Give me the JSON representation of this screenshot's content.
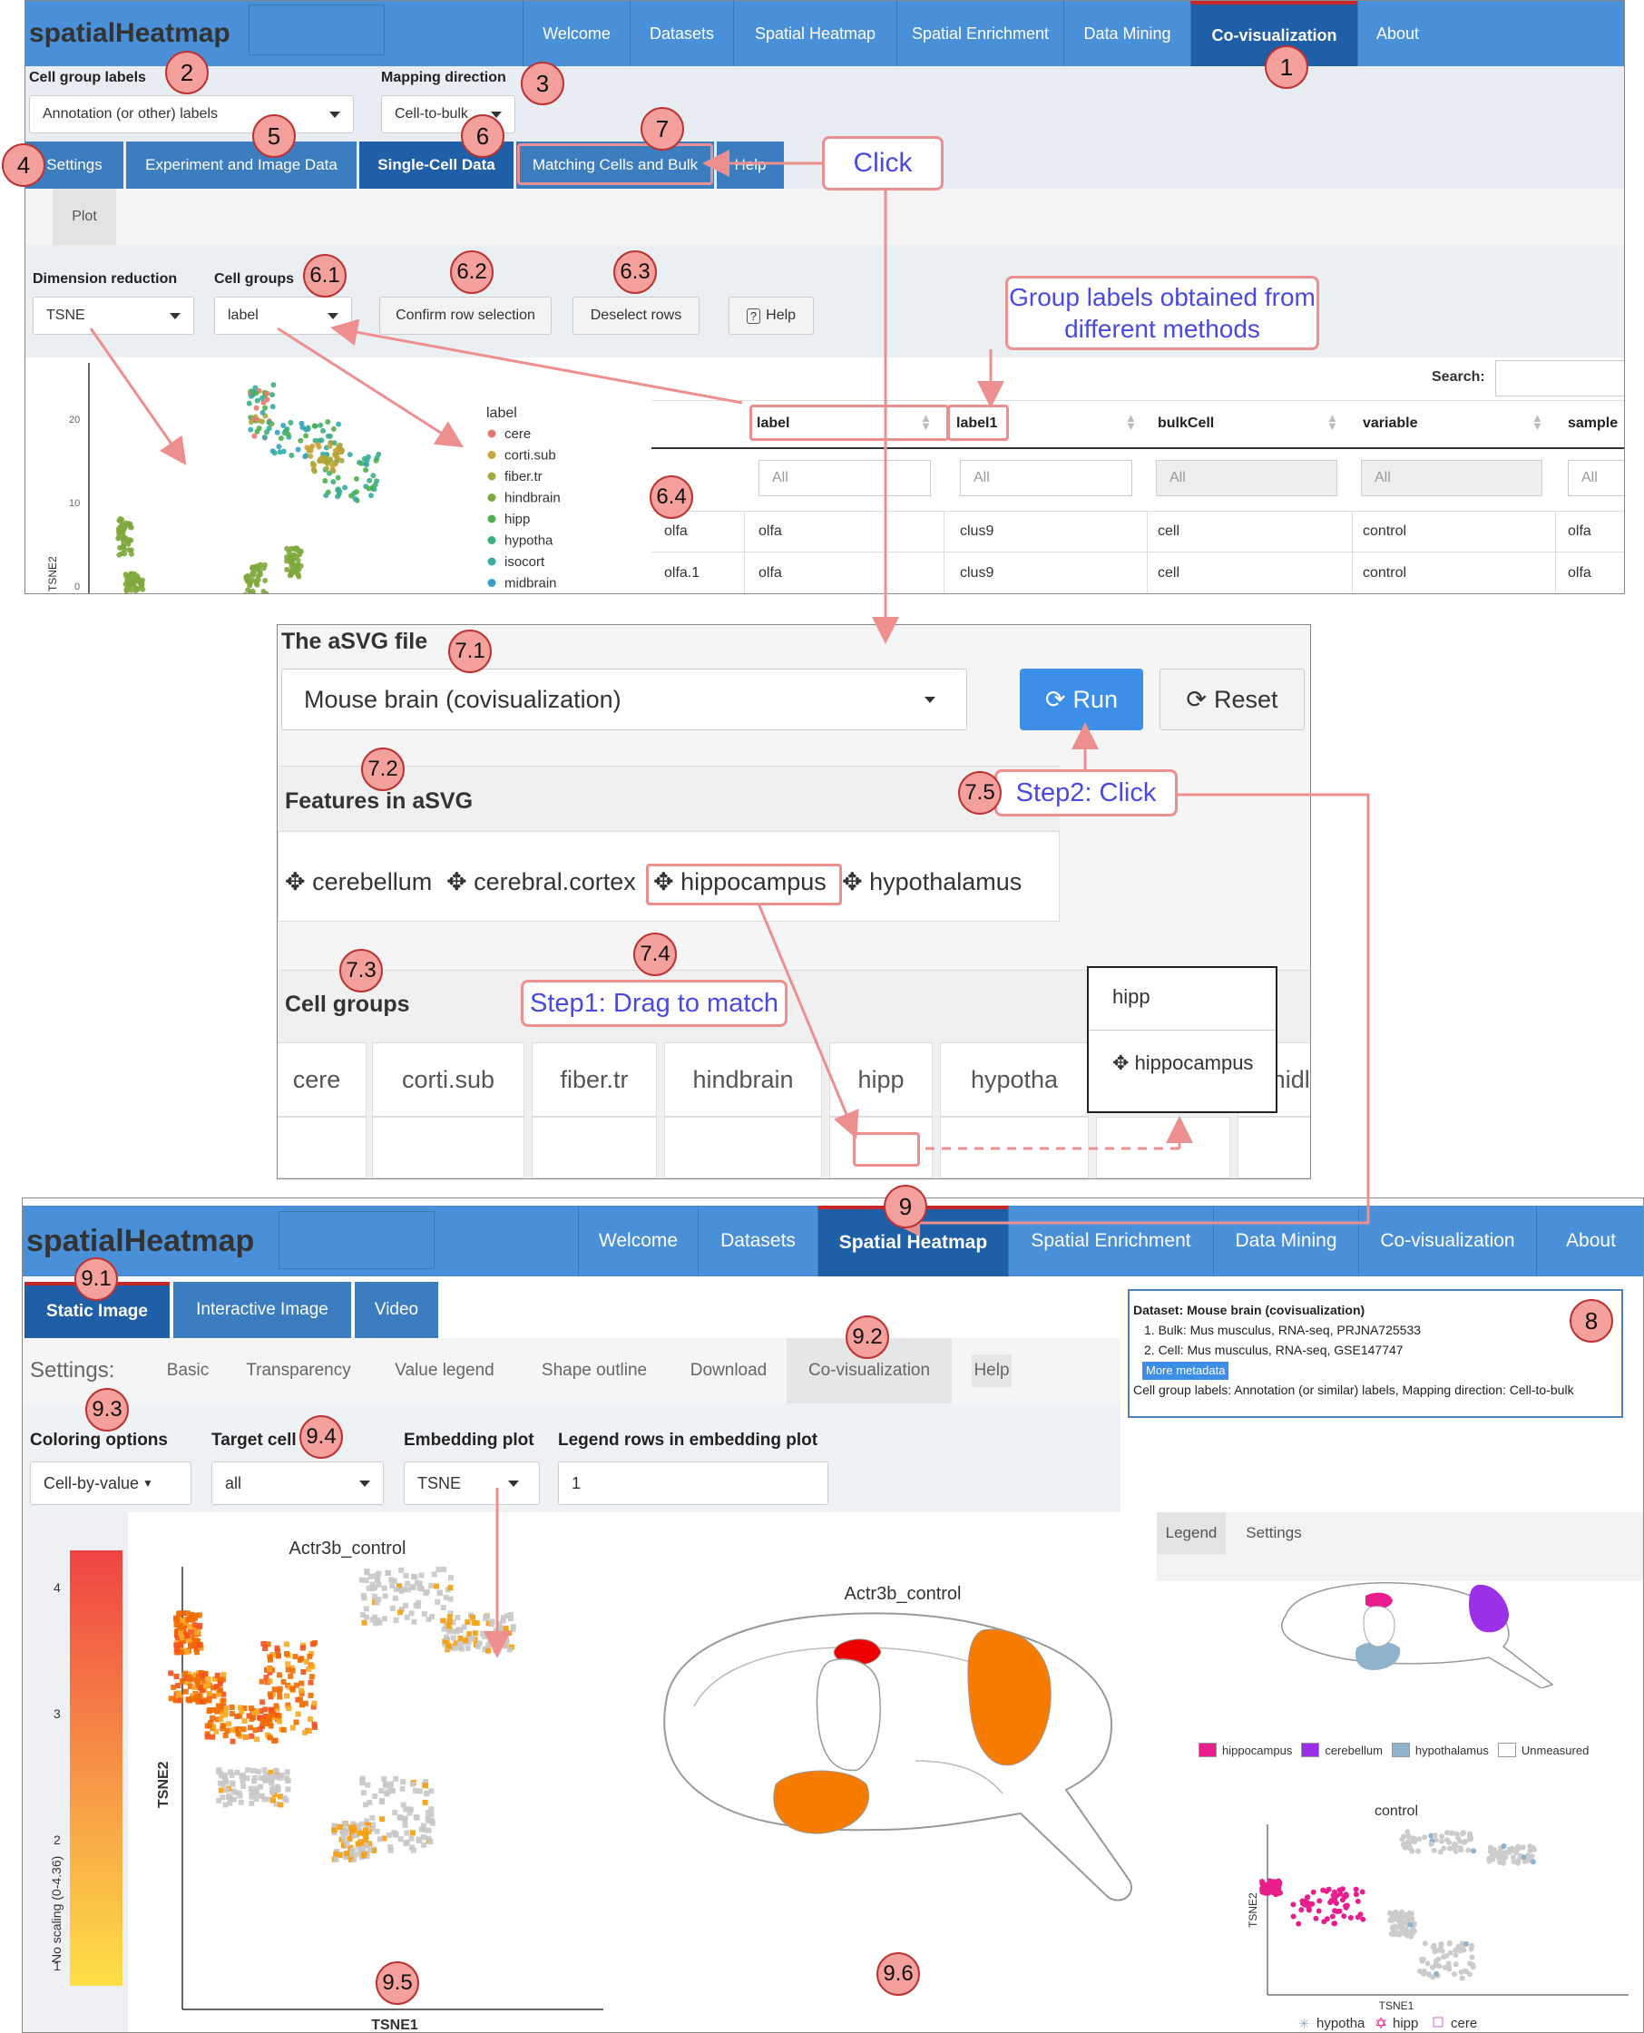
{
  "top": {
    "brand": "spatialHeatmap",
    "nav": [
      "Welcome",
      "Datasets",
      "Spatial Heatmap",
      "Spatial Enrichment",
      "Data Mining",
      "Co-visualization",
      "About"
    ],
    "cell_group_labels_title": "Cell group labels",
    "cell_group_labels_value": "Annotation (or other) labels",
    "mapping_direction_title": "Mapping direction",
    "mapping_direction_value": "Cell-to-bulk",
    "subtabs": [
      "Settings",
      "Experiment and Image Data",
      "Single-Cell Data",
      "Matching Cells and Bulk",
      "Help"
    ],
    "plot_tab": "Plot",
    "dim_reduction_title": "Dimension reduction",
    "dim_reduction_value": "TSNE",
    "cell_groups_title": "Cell groups",
    "cell_groups_value": "label",
    "confirm_btn": "Confirm row selection",
    "deselect_btn": "Deselect rows",
    "help_btn": "Help",
    "search_label": "Search:",
    "scatter": {
      "legend_title": "label",
      "legend": [
        "cere",
        "corti.sub",
        "fiber.tr",
        "hindbrain",
        "hipp",
        "hypotha",
        "isocort",
        "midbrain"
      ],
      "colors": [
        "#e8786e",
        "#c9a23a",
        "#a7a83b",
        "#80a83d",
        "#4cb04c",
        "#3bb07e",
        "#36ada5",
        "#35a1c4"
      ],
      "ylabel": "TSNE2",
      "yticks": [
        "20",
        "10",
        "0"
      ]
    },
    "table": {
      "headers": [
        "",
        "label",
        "label1",
        "bulkCell",
        "variable",
        "sample"
      ],
      "filter": "All",
      "rows": [
        [
          "olfa",
          "olfa",
          "clus9",
          "cell",
          "control",
          "olfa"
        ],
        [
          "olfa.1",
          "olfa",
          "clus9",
          "cell",
          "control",
          "olfa"
        ]
      ]
    }
  },
  "mid": {
    "asvg_title": "The aSVG file",
    "asvg_value": "Mouse brain (covisualization)",
    "run": "Run",
    "reset": "Reset",
    "features_title": "Features in aSVG",
    "features": [
      "cerebellum",
      "cerebral.cortex",
      "hippocampus",
      "hypothalamus"
    ],
    "cell_groups_title": "Cell groups",
    "cell_groups": [
      "cere",
      "corti.sub",
      "fiber.tr",
      "hindbrain",
      "hipp",
      "hypotha",
      "midl"
    ],
    "popup": [
      "hipp",
      "hippocampus"
    ]
  },
  "bottom": {
    "brand": "spatialHeatmap",
    "nav": [
      "Welcome",
      "Datasets",
      "Spatial Heatmap",
      "Spatial Enrichment",
      "Data Mining",
      "Co-visualization",
      "About"
    ],
    "tabs": [
      "Static Image",
      "Interactive Image",
      "Video"
    ],
    "settings_label": "Settings:",
    "settings_tabs": [
      "Basic",
      "Transparency",
      "Value legend",
      "Shape outline",
      "Download",
      "Co-visualization",
      "Help"
    ],
    "metadata": {
      "title": "Dataset: Mouse brain (covisualization)",
      "items": [
        "1. Bulk: Mus musculus, RNA-seq, PRJNA725533",
        "2. Cell: Mus musculus, RNA-seq, GSE147747"
      ],
      "more": "More metadata",
      "footer": "Cell group labels: Annotation (or similar) labels, Mapping direction: Cell-to-bulk"
    },
    "coloring_title": "Coloring options",
    "coloring_value": "Cell-by-value",
    "target_title": "Target cell",
    "target_value": "all",
    "embedding_title": "Embedding plot",
    "embedding_value": "TSNE",
    "legend_rows_title": "Legend rows in embedding plot",
    "legend_rows_value": "1",
    "colorbar": {
      "label": "No scaling (0-4.36)",
      "ticks": [
        "4",
        "3",
        "2",
        "1"
      ],
      "low": "#fde047",
      "high": "#ef4444"
    },
    "embed_title": "Actr3b_control",
    "embed_xlabel": "TSNE1",
    "embed_ylabel": "TSNE2",
    "brain_title": "Actr3b_control",
    "legend_tabs": [
      "Legend",
      "Settings"
    ],
    "tissue_legend": [
      {
        "name": "hippocampus",
        "color": "#e91e8c"
      },
      {
        "name": "cerebellum",
        "color": "#9b30e8"
      },
      {
        "name": "hypothalamus",
        "color": "#8fb3cc"
      },
      {
        "name": "Unmeasured",
        "color": "#ffffff"
      }
    ],
    "mini_title": "control",
    "mini_xlabel": "TSNE1",
    "mini_ylabel": "TSNE2",
    "mini_legend": [
      "hypotha",
      "hipp",
      "cere"
    ]
  },
  "annotations": {
    "badges": [
      "1",
      "2",
      "3",
      "4",
      "5",
      "6",
      "7",
      "6.1",
      "6.2",
      "6.3",
      "6.4",
      "7.1",
      "7.2",
      "7.3",
      "7.4",
      "7.5",
      "9",
      "9.1",
      "9.2",
      "9.3",
      "9.4",
      "8",
      "9.5",
      "9.6"
    ],
    "click": "Click",
    "group_labels": "Group labels obtained from different methods",
    "step2": "Step2: Click",
    "step1": "Step1: Drag to match"
  }
}
